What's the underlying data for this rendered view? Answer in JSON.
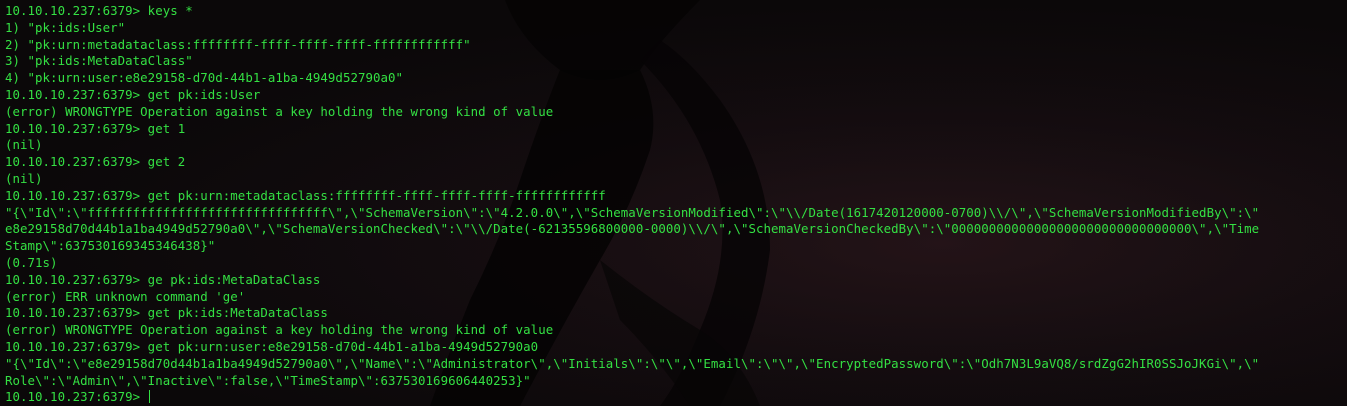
{
  "terminal": {
    "prompt": "10.10.10.237:6379> ",
    "lines": [
      "10.10.10.237:6379> keys *",
      "1) \"pk:ids:User\"",
      "2) \"pk:urn:metadataclass:ffffffff-ffff-ffff-ffff-ffffffffffff\"",
      "3) \"pk:ids:MetaDataClass\"",
      "4) \"pk:urn:user:e8e29158-d70d-44b1-a1ba-4949d52790a0\"",
      "10.10.10.237:6379> get pk:ids:User",
      "(error) WRONGTYPE Operation against a key holding the wrong kind of value",
      "10.10.10.237:6379> get 1",
      "(nil)",
      "10.10.10.237:6379> get 2",
      "(nil)",
      "10.10.10.237:6379> get pk:urn:metadataclass:ffffffff-ffff-ffff-ffff-ffffffffffff",
      "\"{\\\"Id\\\":\\\"ffffffffffffffffffffffffffffffff\\\",\\\"SchemaVersion\\\":\\\"4.2.0.0\\\",\\\"SchemaVersionModified\\\":\\\"\\\\/Date(1617420120000-0700)\\\\/\\\",\\\"SchemaVersionModifiedBy\\\":\\\"",
      "e8e29158d70d44b1a1ba4949d52790a0\\\",\\\"SchemaVersionChecked\\\":\\\"\\\\/Date(-62135596800000-0000)\\\\/\\\",\\\"SchemaVersionCheckedBy\\\":\\\"00000000000000000000000000000000\\\",\\\"Time",
      "Stamp\\\":637530169345346438}\"",
      "(0.71s)",
      "10.10.10.237:6379> ge pk:ids:MetaDataClass",
      "(error) ERR unknown command 'ge'",
      "10.10.10.237:6379> get pk:ids:MetaDataClass",
      "(error) WRONGTYPE Operation against a key holding the wrong kind of value",
      "10.10.10.237:6379> get pk:urn:user:e8e29158-d70d-44b1-a1ba-4949d52790a0",
      "\"{\\\"Id\\\":\\\"e8e29158d70d44b1a1ba4949d52790a0\\\",\\\"Name\\\":\\\"Administrator\\\",\\\"Initials\\\":\\\"\\\",\\\"Email\\\":\\\"\\\",\\\"EncryptedPassword\\\":\\\"Odh7N3L9aVQ8/srdZgG2hIR0SSJoJKGi\\\",\\\"",
      "Role\\\":\\\"Admin\\\",\\\"Inactive\\\":false,\\\"TimeStamp\\\":637530169606440253}\""
    ]
  },
  "colors": {
    "text": "#34e043",
    "background": "#0b0809"
  }
}
